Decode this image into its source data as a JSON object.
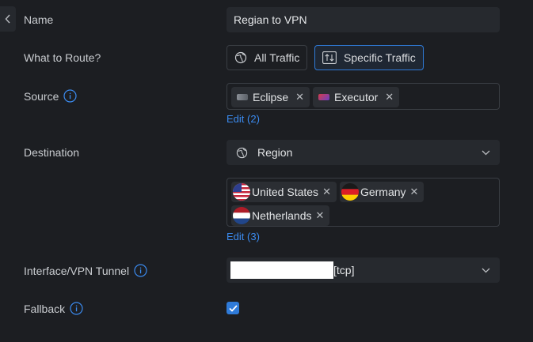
{
  "form": {
    "name": {
      "label": "Name",
      "value": "Regian to VPN"
    },
    "route": {
      "label": "What to Route?",
      "options": [
        {
          "label": "All Traffic",
          "icon": "globe-icon",
          "selected": false
        },
        {
          "label": "Specific Traffic",
          "icon": "arrows-updown-icon",
          "selected": true
        }
      ]
    },
    "source": {
      "label": "Source",
      "chips": [
        {
          "label": "Eclipse",
          "icon": "device-icon"
        },
        {
          "label": "Executor",
          "icon": "device-icon"
        }
      ],
      "edit_label": "Edit (2)"
    },
    "destination": {
      "label": "Destination",
      "type_value": "Region",
      "regions": [
        {
          "label": "United States",
          "flag": "us-flag-icon"
        },
        {
          "label": "Germany",
          "flag": "de-flag-icon"
        },
        {
          "label": "Netherlands",
          "flag": "nl-flag-icon"
        }
      ],
      "edit_label": "Edit (3)"
    },
    "interface": {
      "label": "Interface/VPN Tunnel",
      "value_suffix": "[tcp]"
    },
    "fallback": {
      "label": "Fallback",
      "checked": true
    }
  },
  "colors": {
    "accent": "#2f7bd9",
    "link": "#3b8bf0",
    "background": "#1c1e22",
    "field": "#26292e"
  }
}
